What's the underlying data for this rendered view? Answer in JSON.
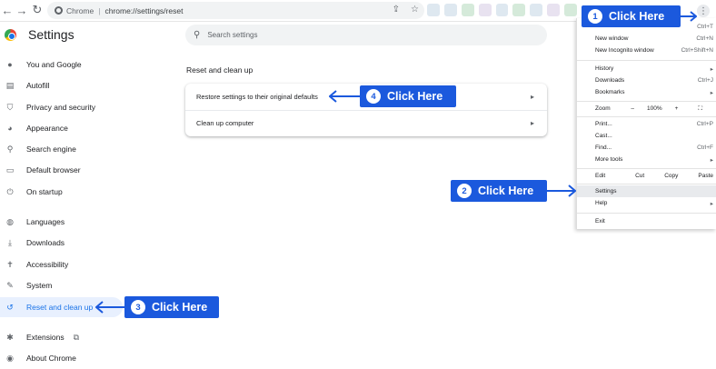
{
  "toolbar": {
    "site_name": "Chrome",
    "url": "chrome://settings/reset"
  },
  "sidebar": {
    "title": "Settings",
    "items": [
      {
        "label": "You and Google",
        "icon": "person-icon"
      },
      {
        "label": "Autofill",
        "icon": "clipboard-icon"
      },
      {
        "label": "Privacy and security",
        "icon": "shield-icon"
      },
      {
        "label": "Appearance",
        "icon": "palette-icon"
      },
      {
        "label": "Search engine",
        "icon": "search-icon"
      },
      {
        "label": "Default browser",
        "icon": "browser-icon"
      },
      {
        "label": "On startup",
        "icon": "power-icon"
      },
      {
        "label": "Languages",
        "icon": "globe-icon"
      },
      {
        "label": "Downloads",
        "icon": "download-icon"
      },
      {
        "label": "Accessibility",
        "icon": "accessibility-icon"
      },
      {
        "label": "System",
        "icon": "wrench-icon"
      },
      {
        "label": "Reset and clean up",
        "icon": "history-icon",
        "active": true
      },
      {
        "label": "Extensions",
        "icon": "puzzle-icon"
      },
      {
        "label": "About Chrome",
        "icon": "chrome-icon"
      }
    ]
  },
  "search": {
    "placeholder": "Search settings"
  },
  "main": {
    "section_title": "Reset and clean up",
    "rows": [
      {
        "label": "Restore settings to their original defaults"
      },
      {
        "label": "Clean up computer"
      }
    ]
  },
  "menu": {
    "items": [
      {
        "label": "",
        "shortcut": "Ctrl+T"
      },
      {
        "label": "New window",
        "shortcut": "Ctrl+N"
      },
      {
        "label": "New Incognito window",
        "shortcut": "Ctrl+Shift+N"
      },
      {
        "label": "History",
        "shortcut": "▸"
      },
      {
        "label": "Downloads",
        "shortcut": "Ctrl+J"
      },
      {
        "label": "Bookmarks",
        "shortcut": "▸"
      },
      {
        "label": "Print...",
        "shortcut": "Ctrl+P"
      },
      {
        "label": "Cast...",
        "shortcut": ""
      },
      {
        "label": "Find...",
        "shortcut": "Ctrl+F"
      },
      {
        "label": "More tools",
        "shortcut": "▸"
      },
      {
        "label": "Settings",
        "shortcut": ""
      },
      {
        "label": "Help",
        "shortcut": "▸"
      },
      {
        "label": "Exit",
        "shortcut": ""
      }
    ],
    "zoom": {
      "label": "Zoom",
      "minus": "–",
      "value": "100%",
      "plus": "+",
      "fullscreen": "⛶"
    },
    "edit": {
      "label": "Edit",
      "cut": "Cut",
      "copy": "Copy",
      "paste": "Paste"
    }
  },
  "callouts": [
    {
      "number": "1",
      "text": "Click Here"
    },
    {
      "number": "2",
      "text": "Click Here"
    },
    {
      "number": "3",
      "text": "Click Here"
    },
    {
      "number": "4",
      "text": "Click Here"
    }
  ],
  "colors": {
    "accent": "#1b59dd",
    "active_bg": "#e8f0fe",
    "active_text": "#1a73e8"
  }
}
